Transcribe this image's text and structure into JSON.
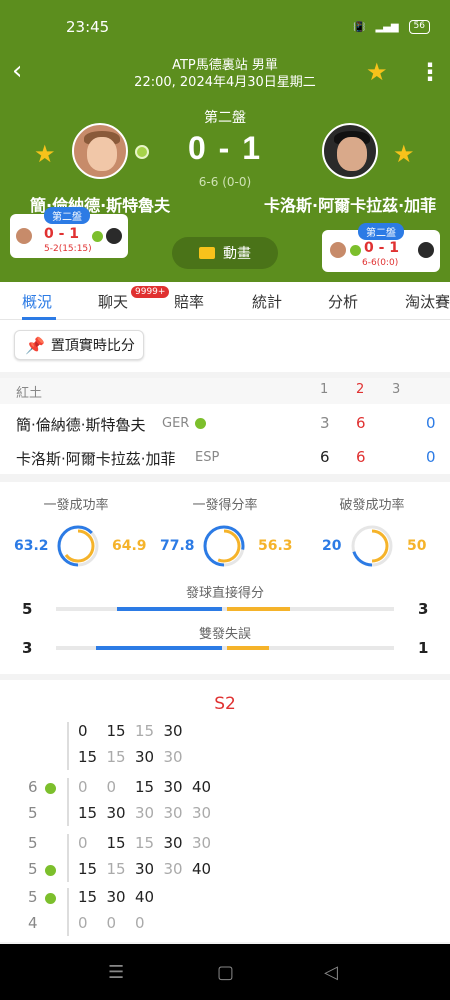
{
  "status": {
    "time": "23:45",
    "battery": "56"
  },
  "header": {
    "title": "ATP馬德裏站 男單",
    "subtitle": "22:00, 2024年4月30日星期二"
  },
  "match": {
    "set_label": "第二盤",
    "score": "0 - 1",
    "sub_score": "6-6 (0-0)",
    "anim_label": "動畫"
  },
  "players": {
    "home": {
      "name": "簡·倫納德·斯特魯夫"
    },
    "away": {
      "name": "卡洛斯·阿爾卡拉茲·加菲"
    }
  },
  "minicards": {
    "left": {
      "tag": "第二盤",
      "score": "0 - 1",
      "sub": "5-2(15:15)"
    },
    "right": {
      "tag": "第二盤",
      "score": "0 - 1",
      "sub": "6-6(0:0)"
    }
  },
  "tabs": [
    "概況",
    "聊天",
    "賠率",
    "統計",
    "分析",
    "淘汰賽"
  ],
  "chat_badge": "9999+",
  "pin_label": "置頂實時比分",
  "score_table": {
    "surface": "紅土",
    "set_headers": [
      "1",
      "2",
      "3"
    ],
    "rows": [
      {
        "name": "簡·倫納德·斯特魯夫",
        "country": "GER",
        "sets": [
          "3",
          "6",
          ""
        ],
        "points": "0"
      },
      {
        "name": "卡洛斯·阿爾卡拉茲·加菲",
        "country": "ESP",
        "sets": [
          "6",
          "6",
          ""
        ],
        "points": "0"
      }
    ]
  },
  "stats": {
    "circles": [
      {
        "title": "一發成功率",
        "home": "63.2",
        "away": "64.9"
      },
      {
        "title": "一發得分率",
        "home": "77.8",
        "away": "56.3"
      },
      {
        "title": "破發成功率",
        "home": "20",
        "away": "50"
      }
    ],
    "bars": [
      {
        "title": "發球直接得分",
        "home": "5",
        "away": "3"
      },
      {
        "title": "雙發失誤",
        "home": "3",
        "away": "1"
      }
    ]
  },
  "pbp": {
    "set_label": "S2",
    "groups": [
      {
        "score_top": "",
        "score_bot": "",
        "top": [
          "0",
          "15",
          "15",
          "30"
        ],
        "top_gray": [
          false,
          false,
          true,
          false
        ],
        "bot": [
          "15",
          "15",
          "30",
          "30"
        ],
        "bot_gray": [
          false,
          true,
          false,
          true
        ]
      },
      {
        "score_top": "6",
        "score_bot": "5",
        "top": [
          "0",
          "0",
          "15",
          "30",
          "40"
        ],
        "top_gray": [
          true,
          true,
          false,
          false,
          false
        ],
        "bot": [
          "15",
          "30",
          "30",
          "30",
          "30"
        ],
        "bot_gray": [
          false,
          false,
          true,
          true,
          true
        ]
      },
      {
        "score_top": "5",
        "score_bot": "5",
        "top": [
          "0",
          "15",
          "15",
          "30",
          "30"
        ],
        "top_gray": [
          true,
          false,
          true,
          false,
          true
        ],
        "bot": [
          "15",
          "15",
          "30",
          "30",
          "40"
        ],
        "bot_gray": [
          false,
          true,
          false,
          true,
          false
        ]
      },
      {
        "score_top": "5",
        "score_bot": "4",
        "top": [
          "15",
          "30",
          "40"
        ],
        "top_gray": [
          false,
          false,
          false
        ],
        "bot": [
          "0",
          "0",
          "0"
        ],
        "bot_gray": [
          true,
          true,
          true
        ]
      }
    ]
  },
  "colors": {
    "header_green": "#5c8e1e",
    "accent_blue": "#2c7be5",
    "accent_red": "#e03131",
    "home_bar": "#2c7be5",
    "away_bar": "#f5b32a"
  }
}
